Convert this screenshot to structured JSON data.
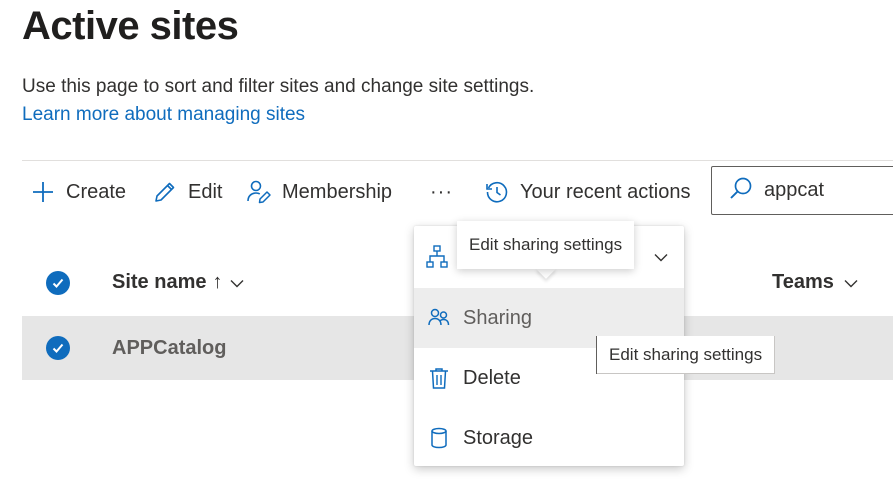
{
  "page": {
    "title": "Active sites",
    "description": "Use this page to sort and filter sites and change site settings.",
    "learn_more": "Learn more about managing sites"
  },
  "commands": {
    "create": "Create",
    "edit": "Edit",
    "membership": "Membership",
    "more": "···",
    "recent": "Your recent actions"
  },
  "search": {
    "value": "appcat",
    "icon": "search-icon"
  },
  "table": {
    "columns": {
      "site_name": "Site name",
      "sort_indicator": "↑",
      "teams": "Teams"
    },
    "rows": [
      {
        "site_name": "APPCatalog",
        "selected": true
      }
    ]
  },
  "menu": {
    "items": [
      {
        "label": "Sharing",
        "icon": "people-icon"
      },
      {
        "label": "Delete",
        "icon": "trash-icon"
      },
      {
        "label": "Storage",
        "icon": "database-icon"
      }
    ]
  },
  "tooltips": {
    "top": "Edit sharing settings",
    "side": "Edit sharing settings"
  },
  "colors": {
    "accent": "#0f6cbd",
    "selected_row": "#e6e6e6",
    "hover_item": "#ededed"
  }
}
